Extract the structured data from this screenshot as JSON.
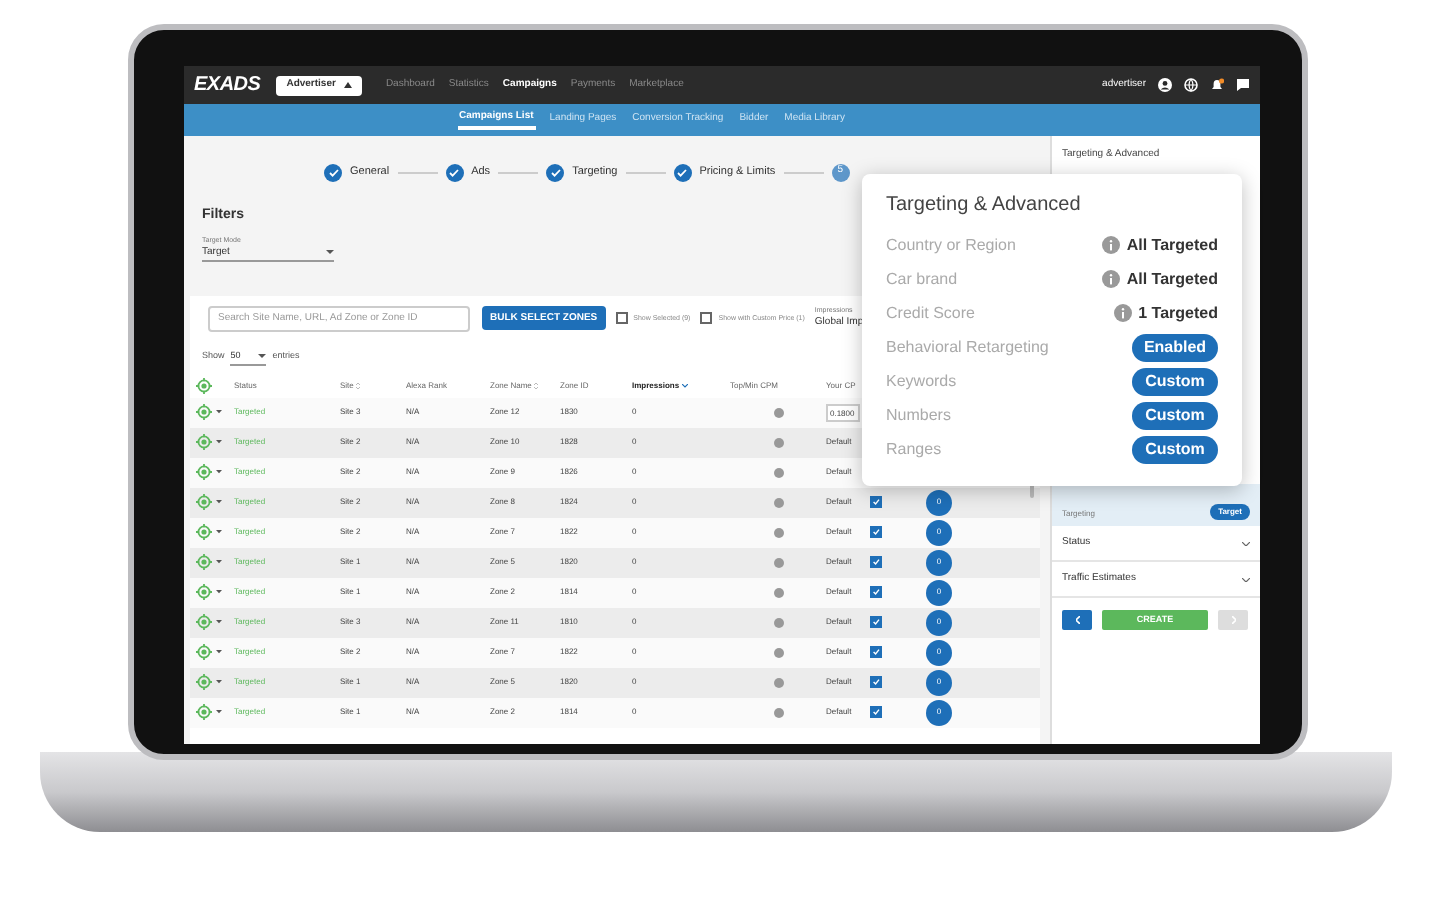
{
  "top_nav": {
    "logo": "EXADS",
    "role_selector": "Advertiser",
    "items": [
      {
        "label": "Dashboard",
        "selected": false
      },
      {
        "label": "Statistics",
        "selected": false
      },
      {
        "label": "Campaigns",
        "selected": true
      },
      {
        "label": "Payments",
        "selected": false
      },
      {
        "label": "Marketplace",
        "selected": false
      }
    ],
    "user": "advertiser"
  },
  "sub_nav": {
    "items": [
      {
        "label": "Campaigns List",
        "selected": true
      },
      {
        "label": "Landing Pages",
        "selected": false
      },
      {
        "label": "Conversion Tracking",
        "selected": false
      },
      {
        "label": "Bidder",
        "selected": false
      },
      {
        "label": "Media Library",
        "selected": false
      }
    ]
  },
  "stepper": {
    "steps": [
      {
        "label": "General",
        "completed": true
      },
      {
        "label": "Ads",
        "completed": true
      },
      {
        "label": "Targeting",
        "completed": true
      },
      {
        "label": "Pricing & Limits",
        "completed": true
      },
      {
        "number": "5",
        "completed": false
      }
    ]
  },
  "filters": {
    "title": "Filters",
    "target_mode": {
      "label": "Target Mode",
      "value": "Target"
    }
  },
  "zone_table": {
    "search": {
      "placeholder": "Search Site Name, URL, Ad Zone or Zone ID"
    },
    "bulk_button": "BULK SELECT ZONES",
    "toggles": [
      {
        "label": "Show Selected (9)",
        "checked": false
      },
      {
        "label": "Show with Custom Price (1)",
        "checked": false
      }
    ],
    "impressions_filter": {
      "label": "Impressions",
      "value": "Global Imp"
    },
    "page_size": {
      "before": "Show",
      "value": "50",
      "after": "entries"
    },
    "columns": [
      {
        "label": "Status",
        "sortable": false,
        "sorted": false
      },
      {
        "label": "Site",
        "sortable": true,
        "sorted": false
      },
      {
        "label": "Alexa Rank",
        "sortable": false,
        "sorted": false
      },
      {
        "label": "Zone Name",
        "sortable": true,
        "sorted": false
      },
      {
        "label": "Zone ID",
        "sortable": false,
        "sorted": false
      },
      {
        "label": "Impressions",
        "sortable": false,
        "sorted": true
      },
      {
        "label": "Top/Min CPM",
        "sortable": false,
        "sorted": false
      },
      {
        "label": "Your CP",
        "sortable": false,
        "sorted": false
      }
    ],
    "rows": [
      {
        "status": "Targeted",
        "site": "Site 3",
        "alexa_rank": "N/A",
        "zone_name": "Zone 12",
        "zone_id": "1830",
        "impressions": "0",
        "cpm": {
          "kind": "input",
          "value": "0.1800"
        }
      },
      {
        "status": "Targeted",
        "site": "Site 2",
        "alexa_rank": "N/A",
        "zone_name": "Zone 10",
        "zone_id": "1828",
        "impressions": "0",
        "cpm": {
          "kind": "text",
          "value": "Default"
        }
      },
      {
        "status": "Targeted",
        "site": "Site 2",
        "alexa_rank": "N/A",
        "zone_name": "Zone 9",
        "zone_id": "1826",
        "impressions": "0",
        "cpm": {
          "kind": "text",
          "value": "Default"
        }
      },
      {
        "status": "Targeted",
        "site": "Site 2",
        "alexa_rank": "N/A",
        "zone_name": "Zone 8",
        "zone_id": "1824",
        "impressions": "0",
        "cpm": {
          "kind": "text",
          "value": "Default"
        },
        "selected": true,
        "bids": "0"
      },
      {
        "status": "Targeted",
        "site": "Site 2",
        "alexa_rank": "N/A",
        "zone_name": "Zone 7",
        "zone_id": "1822",
        "impressions": "0",
        "cpm": {
          "kind": "text",
          "value": "Default"
        },
        "selected": true,
        "bids": "0"
      },
      {
        "status": "Targeted",
        "site": "Site 1",
        "alexa_rank": "N/A",
        "zone_name": "Zone 5",
        "zone_id": "1820",
        "impressions": "0",
        "cpm": {
          "kind": "text",
          "value": "Default"
        },
        "selected": true,
        "bids": "0"
      },
      {
        "status": "Targeted",
        "site": "Site 1",
        "alexa_rank": "N/A",
        "zone_name": "Zone 2",
        "zone_id": "1814",
        "impressions": "0",
        "cpm": {
          "kind": "text",
          "value": "Default"
        },
        "selected": true,
        "bids": "0"
      },
      {
        "status": "Targeted",
        "site": "Site 3",
        "alexa_rank": "N/A",
        "zone_name": "Zone 11",
        "zone_id": "1810",
        "impressions": "0",
        "cpm": {
          "kind": "text",
          "value": "Default"
        },
        "selected": true,
        "bids": "0"
      },
      {
        "status": "Targeted",
        "site": "Site 2",
        "alexa_rank": "N/A",
        "zone_name": "Zone 7",
        "zone_id": "1822",
        "impressions": "0",
        "cpm": {
          "kind": "text",
          "value": "Default"
        },
        "selected": true,
        "bids": "0"
      },
      {
        "status": "Targeted",
        "site": "Site 1",
        "alexa_rank": "N/A",
        "zone_name": "Zone 5",
        "zone_id": "1820",
        "impressions": "0",
        "cpm": {
          "kind": "text",
          "value": "Default"
        },
        "selected": true,
        "bids": "0"
      },
      {
        "status": "Targeted",
        "site": "Site 1",
        "alexa_rank": "N/A",
        "zone_name": "Zone 2",
        "zone_id": "1814",
        "impressions": "0",
        "cpm": {
          "kind": "text",
          "value": "Default"
        },
        "selected": true,
        "bids": "0"
      }
    ]
  },
  "sidebar": {
    "section_title": "Targeting & Advanced",
    "targeting": {
      "label": "Targeting",
      "value": "Target"
    },
    "sections": [
      {
        "label": "Status",
        "expanded": false
      },
      {
        "label": "Traffic Estimates",
        "expanded": false
      }
    ],
    "buttons": [
      {
        "kind": "prev",
        "disabled": false
      },
      {
        "kind": "create",
        "label": "CREATE",
        "disabled": false
      },
      {
        "kind": "next",
        "disabled": true
      }
    ]
  },
  "popup": {
    "title": "Targeting & Advanced",
    "rows": [
      {
        "label": "Country or Region",
        "kind": "info",
        "value": "All Targeted"
      },
      {
        "label": "Car brand",
        "kind": "info",
        "value": "All Targeted"
      },
      {
        "label": "Credit Score",
        "kind": "info",
        "value": "1 Targeted"
      },
      {
        "label": "Behavioral Retargeting",
        "kind": "pill",
        "value": "Enabled"
      },
      {
        "label": "Keywords",
        "kind": "pill",
        "value": "Custom"
      },
      {
        "label": "Numbers",
        "kind": "pill",
        "value": "Custom"
      },
      {
        "label": "Ranges",
        "kind": "pill",
        "value": "Custom"
      }
    ]
  }
}
